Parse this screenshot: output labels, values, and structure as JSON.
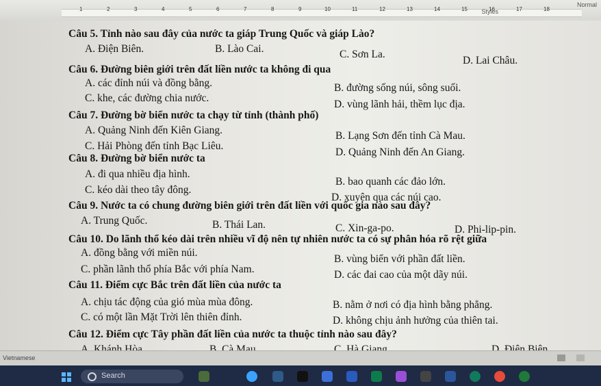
{
  "app": {
    "styles_label": "Styles",
    "normal_label": "Normal"
  },
  "ruler": {
    "ticks": [
      "1",
      "2",
      "3",
      "4",
      "5",
      "6",
      "7",
      "8",
      "9",
      "10",
      "11",
      "12",
      "13",
      "14",
      "15",
      "16",
      "17",
      "18"
    ]
  },
  "doc": {
    "lines": [
      {
        "text": "Câu 5. Tỉnh nào sau đây của nước ta giáp Trung Quốc và giáp Lào?",
        "bold": true
      },
      {
        "text": "A. Điện Biên."
      },
      {
        "text": "B. Lào Cai."
      },
      {
        "text": "C. Sơn La."
      },
      {
        "text": "D. Lai Châu."
      },
      {
        "text": "Câu 6. Đường biên giới trên đất liền nước ta không đi qua",
        "bold": true
      },
      {
        "text": "A. các đỉnh núi và đồng bằng."
      },
      {
        "text": "B. đường sống núi, sông suối."
      },
      {
        "text": "C. khe, các đường chia nước."
      },
      {
        "text": "D. vùng lãnh hải, thềm lục địa."
      },
      {
        "text": "Câu 7. Đường bờ biển nước ta chạy từ tỉnh (thành phố)",
        "bold": true
      },
      {
        "text": "A. Quảng Ninh đến Kiên Giang."
      },
      {
        "text": "B. Lạng Sơn đến tỉnh Cà Mau."
      },
      {
        "text": "C. Hải Phòng đến tỉnh Bạc Liêu."
      },
      {
        "text": "D. Quảng Ninh đến An Giang."
      },
      {
        "text": "Câu 8. Đường bờ biển nước ta",
        "bold": true
      },
      {
        "text": "A. đi qua nhiều địa hình."
      },
      {
        "text": "B. bao quanh các đảo lớn."
      },
      {
        "text": "C. kéo dài theo tây đông."
      },
      {
        "text": "D. xuyên qua các núi cao."
      },
      {
        "text": "Câu 9. Nước ta có chung đường biên giới trên đất liền với quốc gia nào sau đây?",
        "bold": true
      },
      {
        "text": "A. Trung Quốc."
      },
      {
        "text": "B. Thái Lan."
      },
      {
        "text": "C. Xin-ga-po."
      },
      {
        "text": "D. Phi-lip-pin."
      },
      {
        "text": "Câu 10. Do lãnh thổ kéo dài trên nhiều vĩ độ nên tự nhiên nước ta có sự phân hóa rõ rệt giữa",
        "bold": true
      },
      {
        "text": "A. đồng bằng với miền núi."
      },
      {
        "text": "B. vùng biển với phần đất liền."
      },
      {
        "text": "C. phần lãnh thổ phía Bắc với phía Nam."
      },
      {
        "text": "D. các đai cao của một dãy núi."
      },
      {
        "text": "Câu 11. Điểm cực Bắc trên đất liền của nước ta",
        "bold": true
      },
      {
        "text": "A. chịu tác động của gió mùa mùa đông."
      },
      {
        "text": "B. nằm ở nơi có địa hình bằng phẳng."
      },
      {
        "text": "C. có một lần Mặt Trời lên thiên đỉnh."
      },
      {
        "text": "D. không chịu ảnh hưởng của thiên tai."
      },
      {
        "text": "Câu 12. Điểm cực Tây phần đất liền của nước ta thuộc tỉnh nào sau đây?",
        "bold": true
      },
      {
        "text": "A. Khánh Hòa"
      },
      {
        "text": "B. Cà Mau"
      },
      {
        "text": "C. Hà Giang"
      },
      {
        "text": "D. Điện Biên"
      }
    ]
  },
  "status": {
    "language": "Vietnamese"
  },
  "taskbar": {
    "search_placeholder": "Search"
  },
  "colors": {
    "page": "#eeeee9",
    "taskbar": "#1f2a44"
  }
}
